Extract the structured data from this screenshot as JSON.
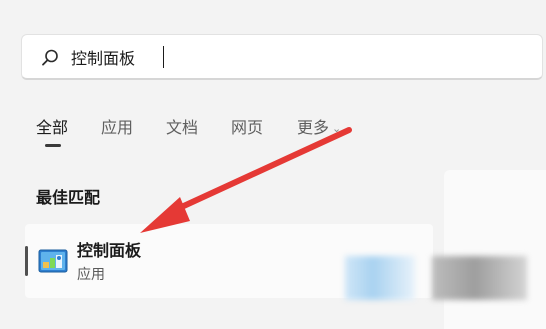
{
  "search": {
    "value": "控制面板",
    "icon": "search-icon"
  },
  "tabs": [
    {
      "label": "全部",
      "active": true
    },
    {
      "label": "应用",
      "active": false
    },
    {
      "label": "文档",
      "active": false
    },
    {
      "label": "网页",
      "active": false
    },
    {
      "label": "更多",
      "active": false,
      "has_dropdown": true
    }
  ],
  "best_match": {
    "heading": "最佳匹配",
    "title": "控制面板",
    "subtitle": "应用",
    "icon": "control-panel-icon"
  },
  "annotation": {
    "type": "arrow",
    "color": "#e53935"
  },
  "colors": {
    "accent": "#0067c0",
    "background": "#f3f3f3"
  }
}
